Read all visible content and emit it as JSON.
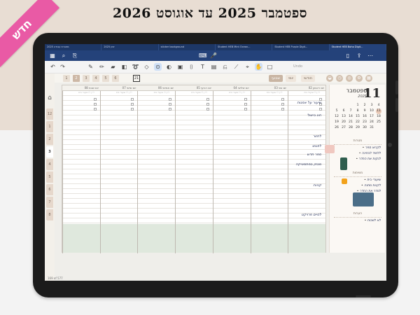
{
  "headline": "ספטמבר 2025 עד אוגוסט 2026",
  "ribbon": {
    "label": "חדש",
    "color": "#e95aa5"
  },
  "browser": {
    "tabs": [
      {
        "label": "מחברת עבודה 2025"
      },
      {
        "label": "2025 יומן"
      },
      {
        "label": "sticker background"
      },
      {
        "label": "Student HEB Mint Ocean..."
      },
      {
        "label": "Student HEB Purple Digit..."
      },
      {
        "label": "Student HEB Boho Digit...",
        "active": true
      }
    ]
  },
  "toolbar": {
    "undo_label": "Undo"
  },
  "nav": {
    "page_numbers": [
      "1",
      "2",
      "3",
      "4",
      "5",
      "6"
    ],
    "active_page": "2",
    "number_box": "21",
    "pills": [
      "שבועי",
      "יומי",
      "חודשי"
    ],
    "month_tabs": [
      "12",
      "1",
      "2",
      "3",
      "4",
      "5",
      "6",
      "7",
      "8"
    ],
    "active_month": "3"
  },
  "week": {
    "days": [
      {
        "label": "יום ראשון 02",
        "sub": "☐ | ☐ שיעורי בית"
      },
      {
        "label": "יום שני 03",
        "sub": "☐ | ☐ שיעורי בית"
      },
      {
        "label": "יום שלישי 04",
        "sub": "☐ | ☐ שיעורי בית"
      },
      {
        "label": "יום רביעי 05",
        "sub": "☐ | ☐ שיעורי בית"
      },
      {
        "label": "יום חמישי 06",
        "sub": "☐ | ☐ שיעורי בית"
      },
      {
        "label": "יום שישי 07",
        "sub": "☐ | ☐ שיעורי בית"
      },
      {
        "label": "יום שבת 08",
        "sub": "☐ | ☐ שיעורי בית"
      }
    ],
    "notes": [
      {
        "text": "שיעור על אמנות"
      },
      {
        "text": "חוג בישול"
      },
      {
        "text": "לחזור"
      },
      {
        "text": "לפגוש"
      },
      {
        "text": "ספר חדש"
      },
      {
        "text": "מבחן במתמטיקה"
      },
      {
        "text": "קניות"
      },
      {
        "text": "לסיים פרויקט"
      }
    ]
  },
  "side": {
    "day": "11",
    "month": "ספטמבר",
    "year": "2025",
    "calendar": [
      [
        "",
        "",
        "",
        "1",
        "2",
        "3",
        "4"
      ],
      [
        "5",
        "6",
        "7",
        "8",
        "9",
        "10",
        "11"
      ],
      [
        "12",
        "13",
        "14",
        "15",
        "16",
        "17",
        "18"
      ],
      [
        "19",
        "20",
        "21",
        "22",
        "23",
        "24",
        "25"
      ],
      [
        "26",
        "27",
        "28",
        "29",
        "30",
        "31",
        ""
      ]
    ],
    "highlight_day": "11",
    "sections": [
      {
        "title": "מטרות",
        "items": [
          "לקרוא ספר",
          "ללמוד לבחינה",
          "לנקות את החדר"
        ]
      },
      {
        "title": "משימות",
        "items": [
          "שיעורי בית",
          "לקנות מתנה",
          "לסדר את החדר"
        ]
      },
      {
        "title": "הערות",
        "items": [
          "לא לשכוח"
        ]
      }
    ]
  },
  "status": {
    "page": "169 of 577"
  },
  "colors": {
    "bg_top": "#e8ddd3",
    "bg_bottom": "#f3f3f3",
    "chrome": "#24427a",
    "accent_tab": "#c9b5a3",
    "ink": "#1f2a54"
  }
}
